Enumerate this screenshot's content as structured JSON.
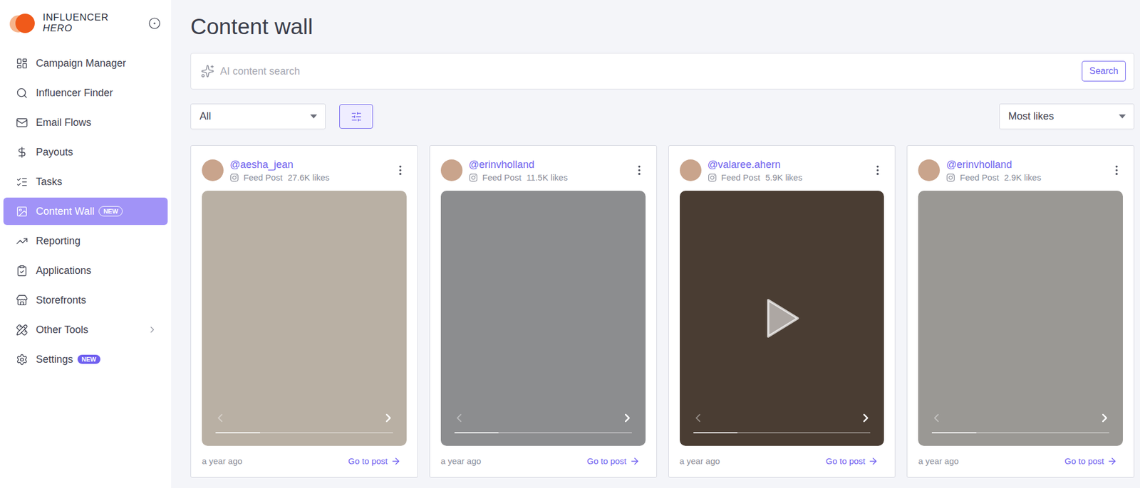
{
  "logo": {
    "line1": "INFLUENCER",
    "line2": "HERO"
  },
  "sidebar": {
    "items": [
      {
        "label": "Campaign Manager",
        "selected": false,
        "badge": "",
        "has_submenu": false
      },
      {
        "label": "Influencer Finder",
        "selected": false,
        "badge": "",
        "has_submenu": false
      },
      {
        "label": "Email Flows",
        "selected": false,
        "badge": "",
        "has_submenu": false
      },
      {
        "label": "Payouts",
        "selected": false,
        "badge": "",
        "has_submenu": false
      },
      {
        "label": "Tasks",
        "selected": false,
        "badge": "",
        "has_submenu": false
      },
      {
        "label": "Content Wall",
        "selected": true,
        "badge": "NEW",
        "has_submenu": false
      },
      {
        "label": "Reporting",
        "selected": false,
        "badge": "",
        "has_submenu": false
      },
      {
        "label": "Applications",
        "selected": false,
        "badge": "",
        "has_submenu": false
      },
      {
        "label": "Storefronts",
        "selected": false,
        "badge": "",
        "has_submenu": false
      },
      {
        "label": "Other Tools",
        "selected": false,
        "badge": "",
        "has_submenu": true
      },
      {
        "label": "Settings",
        "selected": false,
        "badge": "NEW",
        "has_submenu": false
      }
    ]
  },
  "page": {
    "title": "Content wall"
  },
  "search": {
    "placeholder": "AI content search",
    "button": "Search"
  },
  "filter": {
    "value": "All"
  },
  "sort": {
    "value": "Most likes"
  },
  "cards": [
    {
      "handle": "@aesha_jean",
      "type": "Feed Post",
      "likes": "27.6K likes",
      "time": "a year ago",
      "link": "Go to post",
      "video": false
    },
    {
      "handle": "@erinvholland",
      "type": "Feed Post",
      "likes": "11.5K likes",
      "time": "a year ago",
      "link": "Go to post",
      "video": false
    },
    {
      "handle": "@valaree.ahern",
      "type": "Feed Post",
      "likes": "5.9K likes",
      "time": "a year ago",
      "link": "Go to post",
      "video": true
    },
    {
      "handle": "@erinvholland",
      "type": "Feed Post",
      "likes": "2.9K likes",
      "time": "a year ago",
      "link": "Go to post",
      "video": false
    }
  ]
}
